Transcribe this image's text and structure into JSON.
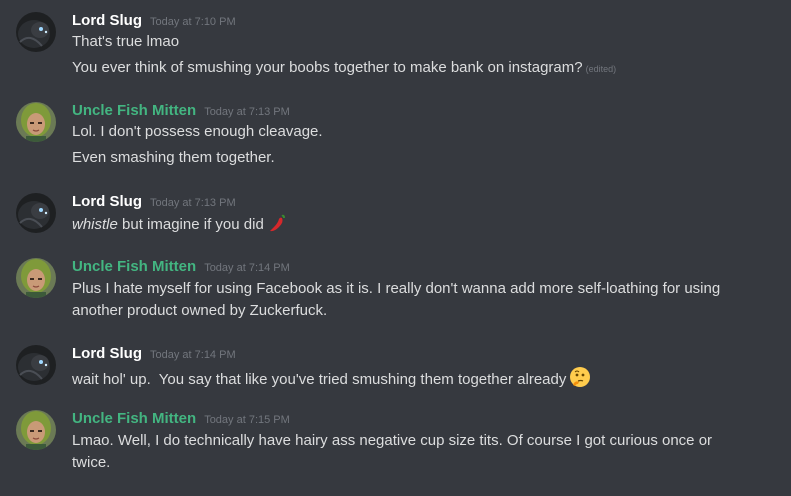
{
  "colors": {
    "background": "#36393f",
    "lord_slug_name": "#ffffff",
    "uncle_fish_name": "#43b581",
    "timestamp": "#72767d",
    "message_text": "#dcddde"
  },
  "messages": [
    {
      "author": "Lord Slug",
      "avatar": "dark-creature-avatar",
      "timestamp": "Today at 7:10 PM",
      "lines": [
        {
          "text": "That's true lmao"
        },
        {
          "text": "You ever think of smushing your boobs together to make bank on instagram?",
          "edited": "(edited)"
        }
      ]
    },
    {
      "author": "Uncle Fish Mitten",
      "avatar": "green-haired-avatar",
      "timestamp": "Today at 7:13 PM",
      "lines": [
        {
          "text": "Lol. I don't possess enough cleavage."
        },
        {
          "text": "Even smashing them together."
        }
      ]
    },
    {
      "author": "Lord Slug",
      "avatar": "dark-creature-avatar",
      "timestamp": "Today at 7:13 PM",
      "lines": [
        {
          "italic": "whistle",
          "text": " but imagine if you did",
          "emoji": "hot-pepper-emoji"
        }
      ]
    },
    {
      "author": "Uncle Fish Mitten",
      "avatar": "green-haired-avatar",
      "timestamp": "Today at 7:14 PM",
      "lines": [
        {
          "text": "Plus I hate myself for using Facebook as it is. I really don't wanna add more self-loathing for using"
        },
        {
          "text": "another product owned by Zuckerfuck."
        }
      ]
    },
    {
      "author": "Lord Slug",
      "avatar": "dark-creature-avatar",
      "timestamp": "Today at 7:14 PM",
      "lines": [
        {
          "text": "wait hol' up.  You say that like you've tried smushing them together already",
          "emoji": "thinking-face-emoji"
        }
      ]
    },
    {
      "author": "Uncle Fish Mitten",
      "avatar": "green-haired-avatar",
      "timestamp": "Today at 7:15 PM",
      "lines": [
        {
          "text": "Lmao. Well, I do technically have hairy ass negative cup size tits. Of course I got curious once or"
        },
        {
          "text": "twice."
        }
      ]
    }
  ]
}
